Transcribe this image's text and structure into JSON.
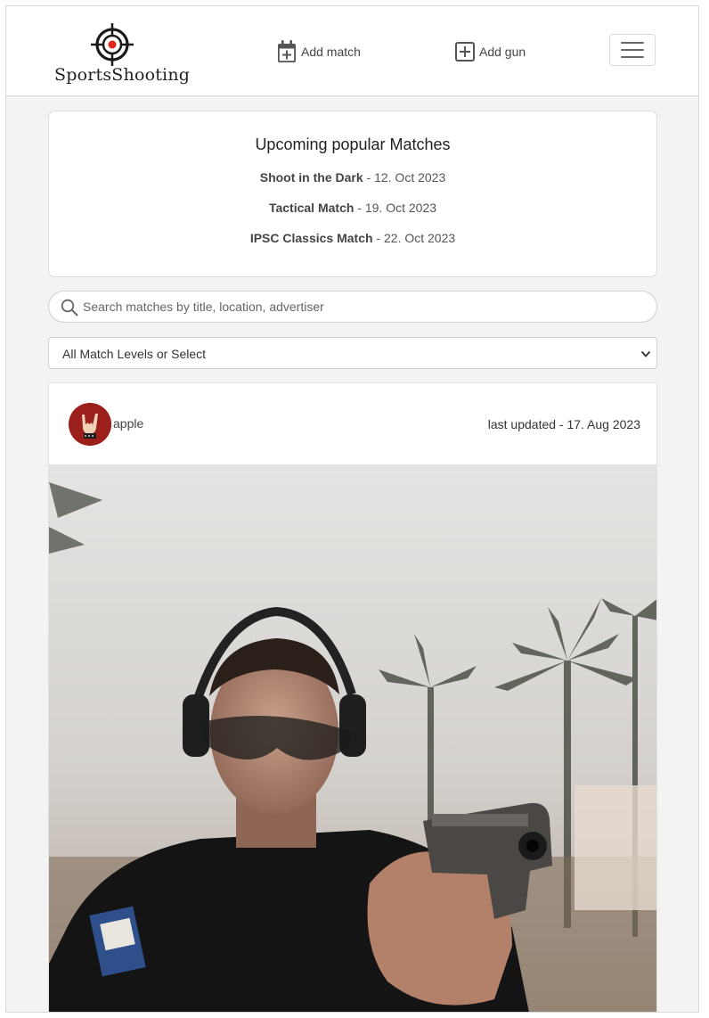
{
  "brand": {
    "name": "SportsShooting",
    "accent": "#e0281b"
  },
  "nav": {
    "add_match": "Add match",
    "add_gun": "Add gun",
    "add_match_icon": "calendar-plus-icon",
    "add_gun_icon": "plus-square-icon",
    "menu_icon": "hamburger-menu-icon"
  },
  "upcoming": {
    "title": "Upcoming popular Matches",
    "matches": [
      {
        "name": "Shoot in the Dark",
        "date": " - 12. Oct 2023"
      },
      {
        "name": "Tactical Match",
        "date": " - 19. Oct 2023"
      },
      {
        "name": "IPSC Classics Match",
        "date": " - 22. Oct 2023"
      }
    ]
  },
  "search": {
    "placeholder": "Search matches by title, location, advertiser",
    "value": ""
  },
  "filter": {
    "selected": "All Match Levels or Select"
  },
  "post": {
    "author": "apple",
    "updated": "last updated - 17. Aug 2023",
    "avatar_icon": "rock-hand-avatar",
    "image_subject": "shooter-aiming-pistol-photo"
  }
}
